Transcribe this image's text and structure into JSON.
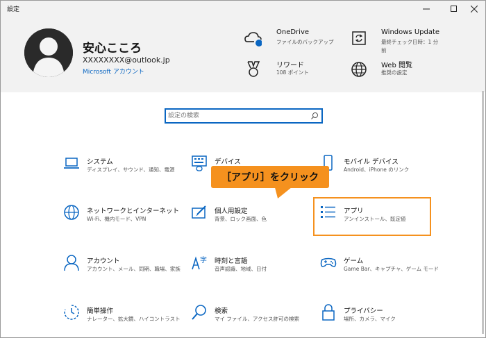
{
  "window": {
    "title": "設定"
  },
  "header": {
    "user": {
      "name": "安心こころ",
      "email": "XXXXXXXX@outlook.jp",
      "account_link": "Microsoft アカウント"
    },
    "items": [
      {
        "title": "OneDrive",
        "subtitle": "ファイルのバックアップ",
        "icon": "onedrive-cloud-icon"
      },
      {
        "title": "Windows Update",
        "subtitle_line1": "最終チェック日時：1 分",
        "subtitle_line2": "前",
        "icon": "windows-update-icon"
      },
      {
        "title": "リワード",
        "subtitle": "108 ポイント",
        "icon": "rewards-medal-icon"
      },
      {
        "title": "Web 閲覧",
        "subtitle": "推奨の設定",
        "icon": "globe-icon"
      }
    ]
  },
  "search": {
    "placeholder": "設定の検索"
  },
  "tiles": [
    {
      "title": "システム",
      "desc": "ディスプレイ、サウンド、通知、電源",
      "icon": "laptop-icon"
    },
    {
      "title": "デバイス",
      "desc": "",
      "icon": "keyboard-device-icon"
    },
    {
      "title": "モバイル デバイス",
      "desc": "Android、iPhone のリンク",
      "icon": "phone-icon"
    },
    {
      "title": "ネットワークとインターネット",
      "desc": "Wi-Fi、機内モード、VPN",
      "icon": "globe-network-icon"
    },
    {
      "title": "個人用設定",
      "desc": "背景、ロック画面、色",
      "icon": "paint-brush-icon"
    },
    {
      "title": "アプリ",
      "desc": "アンインストール、既定値",
      "icon": "apps-list-icon"
    },
    {
      "title": "アカウント",
      "desc": "アカウント、メール、同期、職場、家族",
      "icon": "person-icon"
    },
    {
      "title": "時刻と言語",
      "desc": "音声認識、地域、日付",
      "icon": "time-language-icon"
    },
    {
      "title": "ゲーム",
      "desc": "Game Bar、キャプチャ、ゲーム モード",
      "icon": "gamepad-icon"
    },
    {
      "title": "簡単操作",
      "desc": "ナレーター、拡大鏡、ハイコントラスト",
      "icon": "ease-of-access-icon"
    },
    {
      "title": "検索",
      "desc": "マイ ファイル、アクセス許可の検索",
      "icon": "search-magnifier-icon"
    },
    {
      "title": "プライバシー",
      "desc": "場所、カメラ、マイク",
      "icon": "lock-icon"
    }
  ],
  "annotation": {
    "callout": "［アプリ］をクリック",
    "color": "#f5911e"
  },
  "colors": {
    "accent": "#0a66c2",
    "header_bg": "#f2f2f2"
  }
}
